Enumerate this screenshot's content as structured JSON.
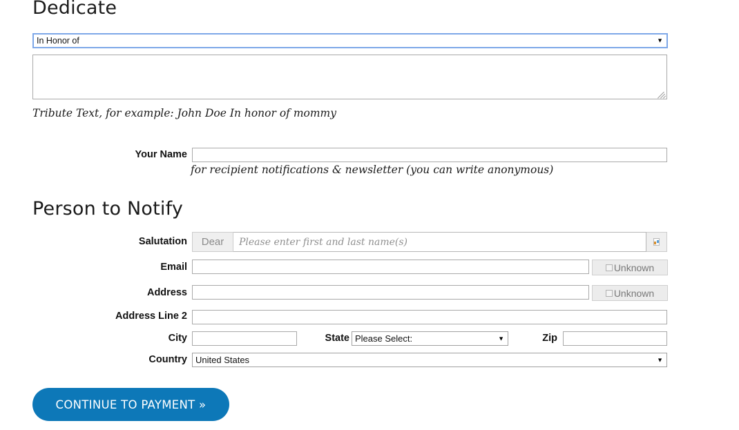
{
  "dedicate": {
    "heading": "Dedicate",
    "type_select": {
      "value": "In Honor of",
      "caret": "▼"
    },
    "tribute_textarea": {
      "value": "",
      "placeholder": ""
    },
    "tribute_hint": "Tribute Text, for example: John Doe In honor of mommy"
  },
  "your_name": {
    "label": "Your Name",
    "value": "",
    "hint": "for recipient notifications & newsletter (you can write anonymous)"
  },
  "person_to_notify": {
    "heading": "Person to Notify",
    "salutation": {
      "label": "Salutation",
      "prefix": "Dear",
      "placeholder": "Please enter first and last name(s)",
      "value": "",
      "suffix_icon": "broken-image-icon"
    },
    "email": {
      "label": "Email",
      "value": "",
      "unknown_label": "Unknown",
      "unknown_checked": false
    },
    "address": {
      "label": "Address",
      "value": "",
      "unknown_label": "Unknown",
      "unknown_checked": false
    },
    "address_line_2": {
      "label": "Address Line 2",
      "value": ""
    },
    "city": {
      "label": "City",
      "value": ""
    },
    "state": {
      "label": "State",
      "value": "Please Select:",
      "caret": "▼"
    },
    "zip": {
      "label": "Zip",
      "value": ""
    },
    "country": {
      "label": "Country",
      "value": "United States",
      "caret": "▼"
    }
  },
  "submit": {
    "label": "CONTINUE TO PAYMENT »"
  },
  "colors": {
    "button_blue": "#0d78b8",
    "select_focus_border": "#7da7e8",
    "input_border": "#a9a9a9",
    "addon_bg": "#efefef",
    "muted_text": "#8a8a8a"
  }
}
